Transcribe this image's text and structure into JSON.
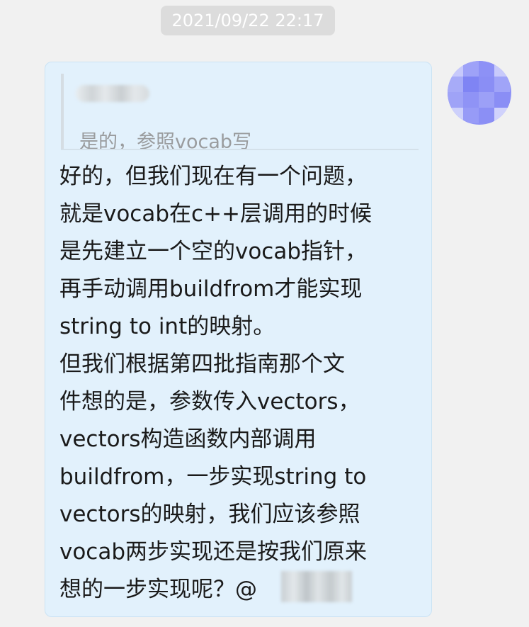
{
  "chat": {
    "timestamp": "2021/09/22 22:17",
    "message": {
      "quote": {
        "text": "是的，参照vocab写"
      },
      "lines": [
        "好的，但我们现在有一个问题，",
        "就是vocab在c++层调用的时候",
        "是先建立一个空的vocab指针，",
        "再手动调用buildfrom才能实现",
        "string to int的映射。",
        "但我们根据第四批指南那个文",
        "件想的是，参数传入vectors，",
        "vectors构造函数内部调用",
        "buildfrom，一步实现string  to",
        "vectors的映射，我们应该参照",
        "vocab两步实现还是按我们原来",
        "想的一步实现呢？@"
      ]
    }
  },
  "colors": {
    "background": "#f1f1f1",
    "bubble": "#e2f1fc",
    "avatar": "#8e92f6",
    "timestamp_bg": "#dcdcdc"
  }
}
